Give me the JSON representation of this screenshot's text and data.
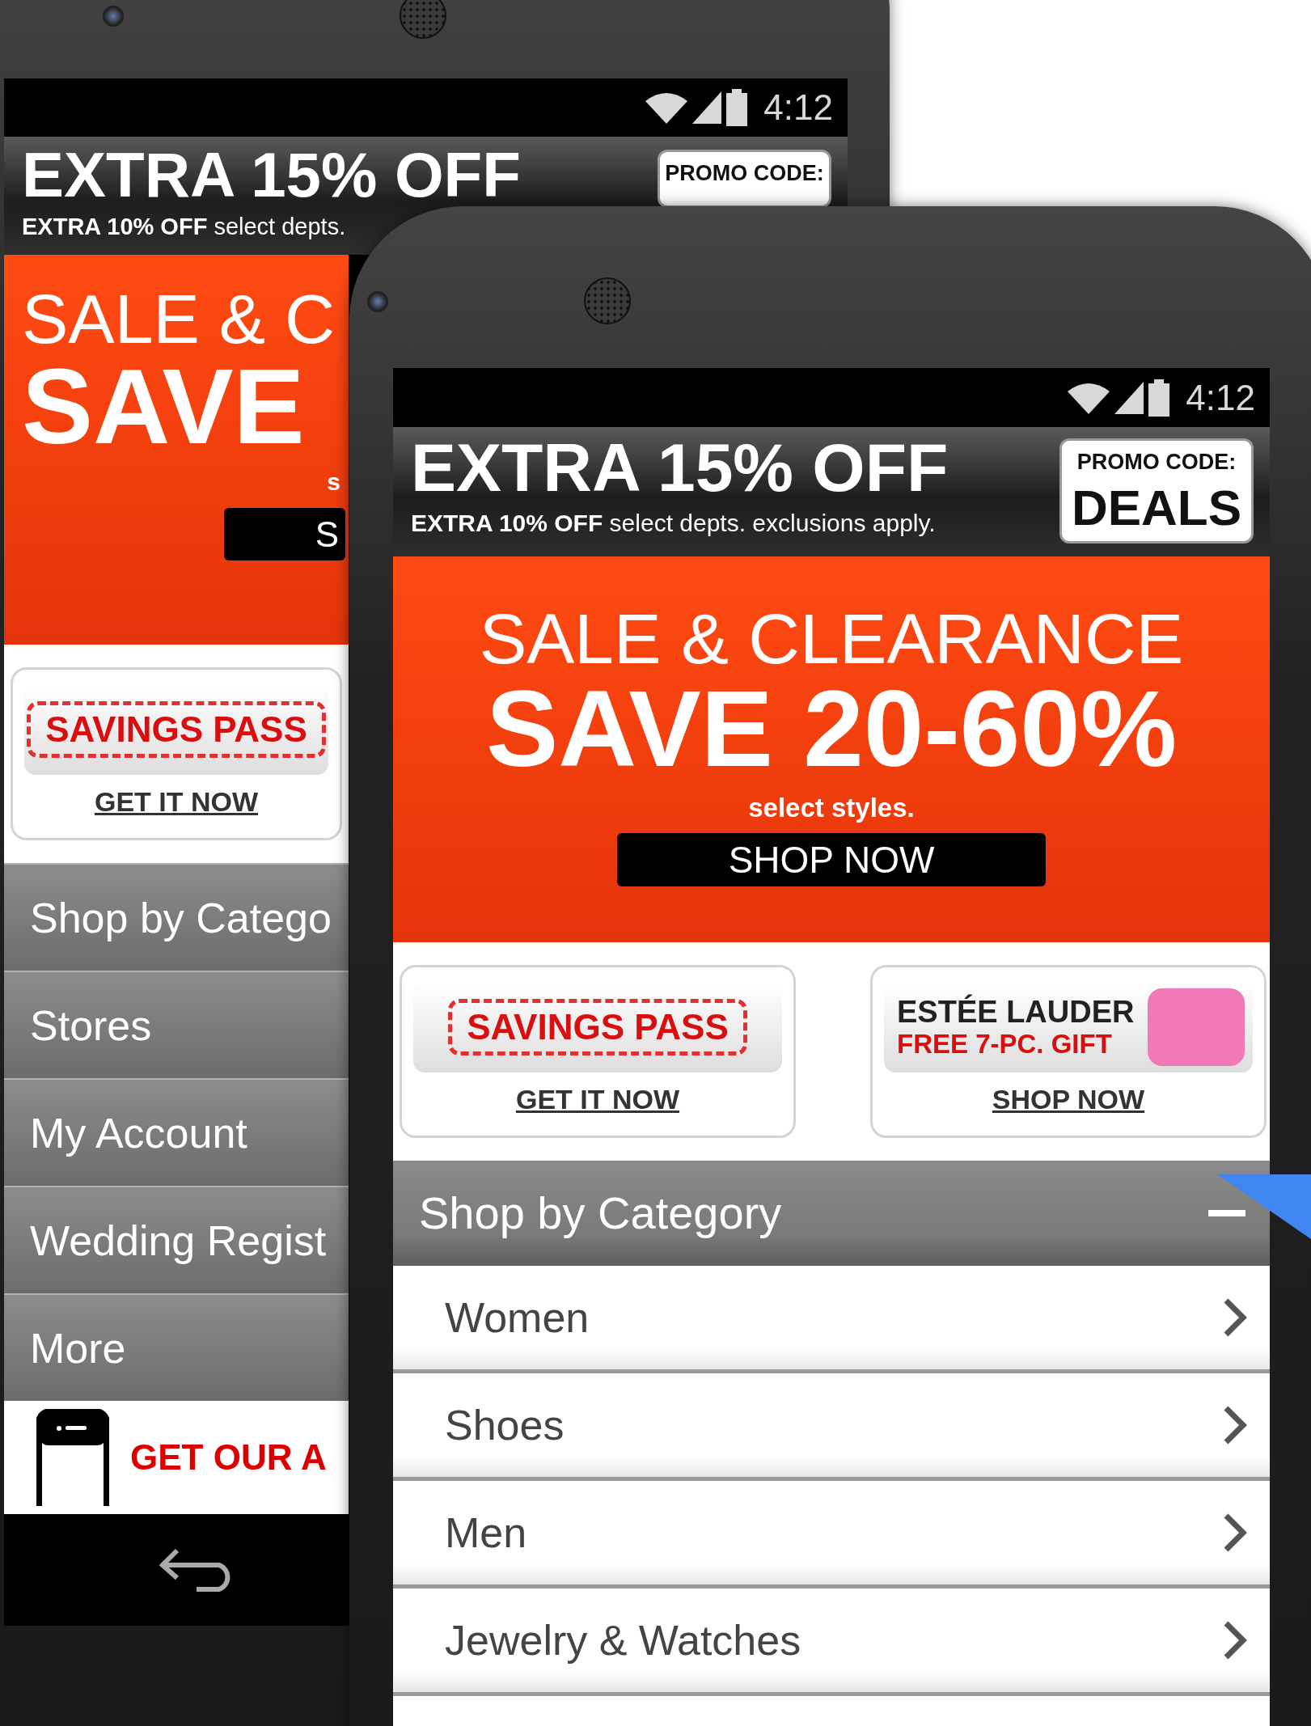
{
  "back_phone": {
    "status_bar": {
      "time": "4:12"
    },
    "promo_banner": {
      "headline": "EXTRA 15% OFF",
      "subline": "**EXTRA 10% OFF** select depts.",
      "promo_label": "PROMO CODE:"
    },
    "hero": {
      "line_1": "SALE & C",
      "line_2": "SAVE",
      "note": "s",
      "button": "S"
    },
    "tiles": [
      {
        "kind": "savings",
        "title": "SAVINGS PASS",
        "link": "GET IT NOW"
      }
    ],
    "menu": [
      {
        "label": "Shop by Catego"
      },
      {
        "label": "Stores"
      },
      {
        "label": "My Account"
      },
      {
        "label": "Wedding Regist"
      },
      {
        "label": "More"
      }
    ],
    "app_banner": {
      "text": "GET OUR A"
    }
  },
  "front_phone": {
    "status_bar": {
      "time": "4:12"
    },
    "promo_banner": {
      "headline": "EXTRA 15% OFF",
      "subline": "**EXTRA 10% OFF** select depts. exclusions apply.",
      "promo_label": "PROMO CODE:",
      "promo_code": "DEALS"
    },
    "hero": {
      "line_1": "SALE & CLEARANCE",
      "line_2": "SAVE 20-60%",
      "note": "select styles.",
      "button": "SHOP NOW"
    },
    "tiles": [
      {
        "kind": "savings",
        "title": "SAVINGS PASS",
        "link": "GET IT NOW"
      },
      {
        "kind": "brand",
        "brand": "ESTÉE LAUDER",
        "offer": "FREE 7-PC. GIFT",
        "link": "SHOP NOW"
      }
    ],
    "category_menu": {
      "title": "Shop by Category",
      "expanded": true,
      "items": [
        {
          "label": "Women"
        },
        {
          "label": "Shoes"
        },
        {
          "label": "Men"
        },
        {
          "label": "Jewelry & Watches"
        }
      ]
    }
  }
}
